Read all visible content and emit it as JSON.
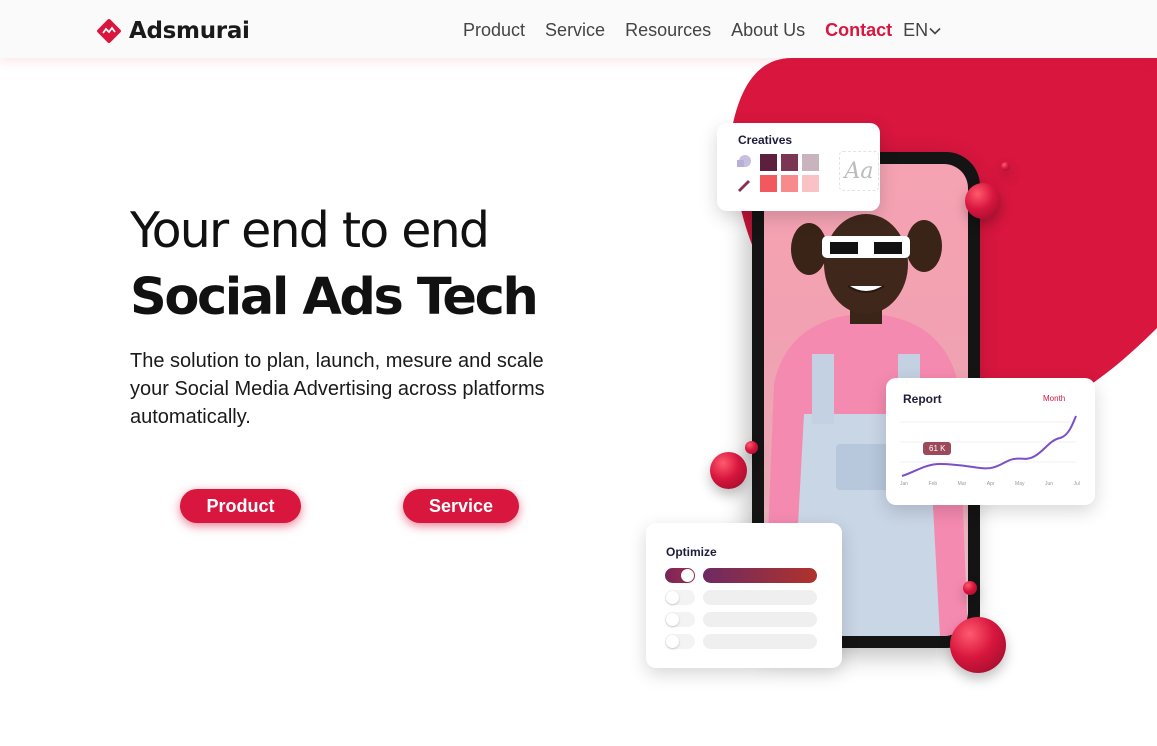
{
  "header": {
    "logo_text": "Adsmurai",
    "nav": [
      {
        "label": "Product"
      },
      {
        "label": "Service"
      },
      {
        "label": "Resources"
      },
      {
        "label": "About Us"
      },
      {
        "label": "Contact",
        "active": true
      }
    ],
    "language": "EN"
  },
  "hero": {
    "title_line1": "Your end to end",
    "title_line2": "Social Ads Tech",
    "description": "The solution to plan, launch, mesure and scale your Social Media Advertising across platforms automatically.",
    "buttons": {
      "product": "Product",
      "service": "Service"
    }
  },
  "illustration": {
    "creatives_card": {
      "title": "Creatives",
      "font_sample": "Aa",
      "swatch_colors": [
        "#5c1f3e",
        "#7a3654",
        "#c9b3bf",
        "#f1595f",
        "#f78a8d",
        "#f9c3c6"
      ]
    },
    "report_card": {
      "title": "Report",
      "period": "Month",
      "badge": "61 K",
      "x_labels": [
        "Jan",
        "Feb",
        "Mar",
        "Apr",
        "May",
        "Jun",
        "Jul"
      ]
    },
    "optimize_card": {
      "title": "Optimize"
    }
  },
  "colors": {
    "brand": "#d8163e",
    "text": "#111111"
  }
}
